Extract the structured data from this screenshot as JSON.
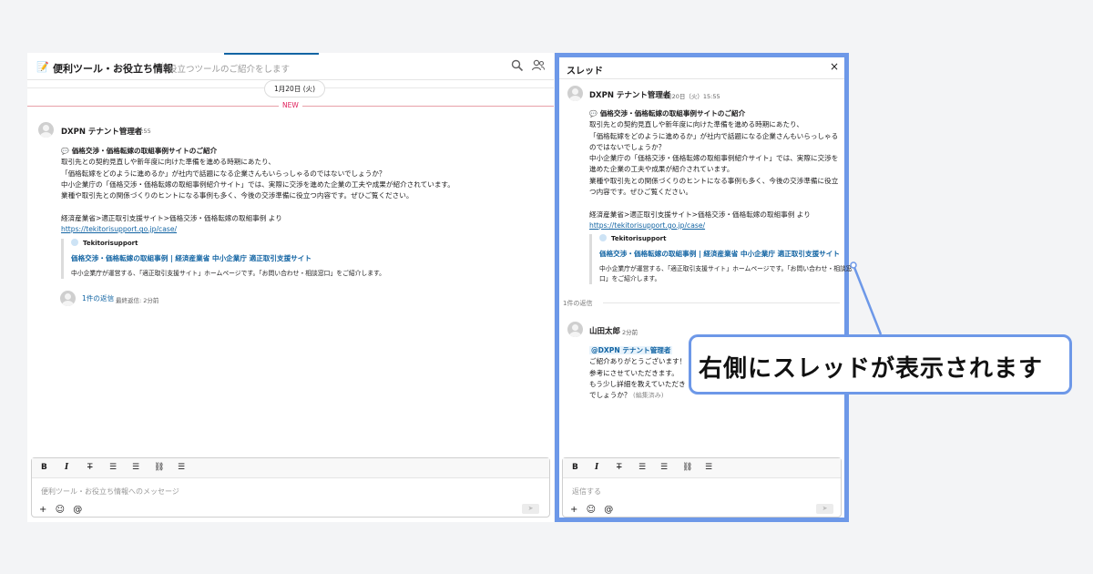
{
  "channel": {
    "icon": "memo-icon",
    "name": "便利ツール・お役立ち情報",
    "topic": "役立つツールのご紹介をします",
    "date_divider": "1月20日 (火)",
    "new_label": "NEW"
  },
  "post": {
    "sender": "DXPN テナント管理者",
    "time": "15:55",
    "heading": "価格交渉・価格転嫁の取組事例サイトのご紹介",
    "lines_main": [
      "取引先との契約見直しや新年度に向けた準備を進める時期にあたり、",
      "「価格転嫁をどのように進めるか」が社内で話題になる企業さんもいらっしゃるのではないでしょうか？",
      "中小企業庁の「価格交渉・価格転嫁の取組事例紹介サイト」では、実際に交渉を進めた企業の工夫や成果が紹介されています。",
      "業種や取引先との関係づくりのヒントになる事例も多く、今後の交渉準備に役立つ内容です。ぜひご覧ください。"
    ],
    "lines_thread": [
      "取引先との契約見直しや新年度に向けた準備を進める時期にあたり、",
      "「価格転嫁をどのように進めるか」が社内で話題になる企業さんもいらっしゃる",
      "のではないでしょうか？",
      "中小企業庁の「価格交渉・価格転嫁の取組事例紹介サイト」では、実際に交渉を",
      "進めた企業の工夫や成果が紹介されています。",
      "業種や取引先との関係づくりのヒントになる事例も多く、今後の交渉準備に役立",
      "つ内容です。ぜひご覧ください。"
    ],
    "source_line": "経済産業省>適正取引支援サイト>価格交渉・価格転嫁の取組事例 より",
    "url": "https://tekitorisupport.go.jp/case/",
    "unfurl": {
      "site": "Tekitorisupport",
      "title": "価格交渉・価格転嫁の取組事例 | 経済産業省 中小企業庁 適正取引支援サイト",
      "desc_main": "中小企業庁が運営する、「適正取引支援サイト」ホームページです。「お問い合わせ・相談窓口」をご紹介します。",
      "desc_thread": [
        "中小企業庁が運営する、「適正取引支援サイト」ホームページです。「お問い合わせ・相談窓",
        "口」をご紹介します。"
      ]
    },
    "replies_link": "1件の返信",
    "replies_meta": "最終返信: 2分前"
  },
  "thread": {
    "title": "スレッド",
    "close": "×",
    "timestamp": "1月20日（火）15:55",
    "reply_count": "1件の返信",
    "reply": {
      "sender": "山田太郎",
      "time": "2分前",
      "mention": "@DXPN テナント管理者",
      "lines": [
        "ご紹介ありがとうございます！",
        "参考にさせていただきます。",
        "もう少し詳細を教えていただき",
        "でしょうか？"
      ],
      "edited": "(編集済み)"
    }
  },
  "composer_main": {
    "placeholder": "便利ツール・お役立ち情報へのメッセージ"
  },
  "composer_thread": {
    "placeholder": "返信する"
  },
  "toolbar": {
    "bold": "B",
    "italic": "I",
    "strike": "T",
    "bullets": "☰",
    "numbered": "☰",
    "link": "⛓",
    "blockquote": "☰",
    "plus": "+",
    "emoji": "☺",
    "mention": "@",
    "send": "➤"
  },
  "callout": {
    "text": "右側にスレッドが表示されます"
  },
  "colors": {
    "accent_blue": "#6d98e8",
    "link_blue": "#1264a3",
    "new_red": "#e01e5a"
  }
}
